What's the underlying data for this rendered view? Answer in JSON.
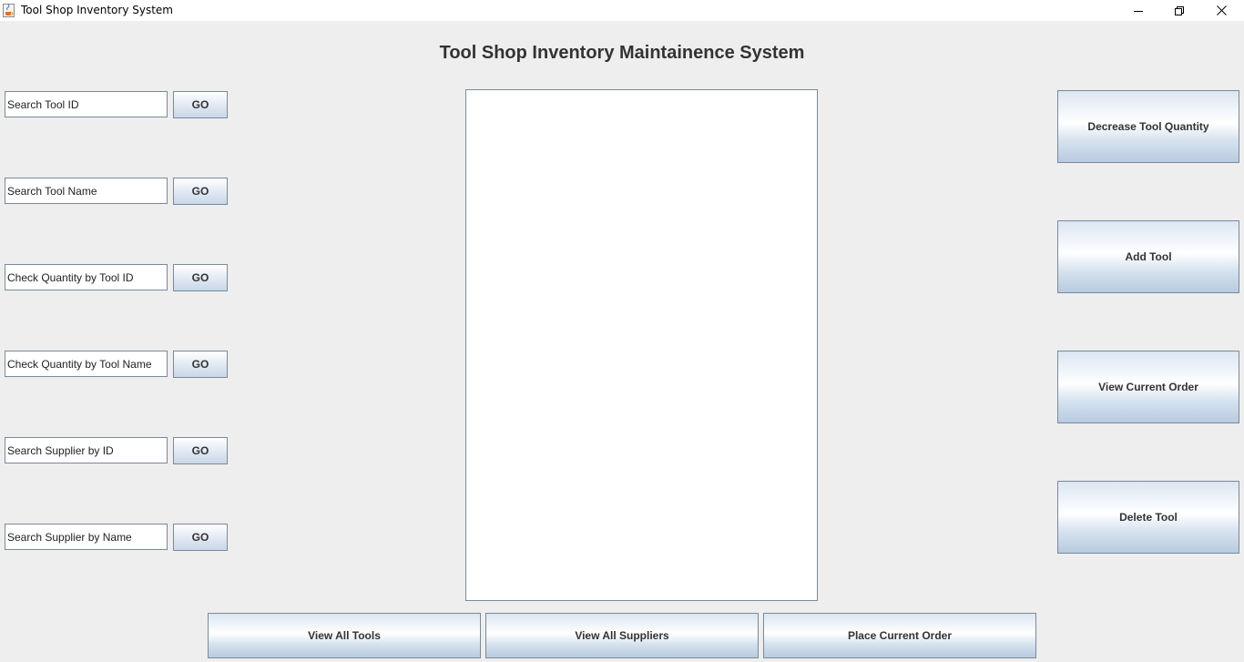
{
  "window": {
    "title": "Tool Shop Inventory System",
    "icon": "java-cup-icon",
    "controls": [
      "minimize-icon",
      "restore-icon",
      "close-icon"
    ]
  },
  "heading": "Tool Shop Inventory Maintainence System",
  "search_rows": [
    {
      "value": "Search Tool ID",
      "button": "GO"
    },
    {
      "value": "Search Tool Name",
      "button": "GO"
    },
    {
      "value": "Check Quantity by Tool ID",
      "button": "GO"
    },
    {
      "value": "Check Quantity by Tool Name",
      "button": "GO"
    },
    {
      "value": "Search Supplier by ID",
      "button": "GO"
    },
    {
      "value": "Search Supplier by Name",
      "button": "GO"
    }
  ],
  "display_area": {
    "value": ""
  },
  "right_buttons": [
    "Decrease Tool Quantity",
    "Add Tool",
    "View Current Order",
    "Delete Tool"
  ],
  "bottom_buttons": [
    "View All Tools",
    "View All Suppliers",
    "Place Current Order"
  ]
}
